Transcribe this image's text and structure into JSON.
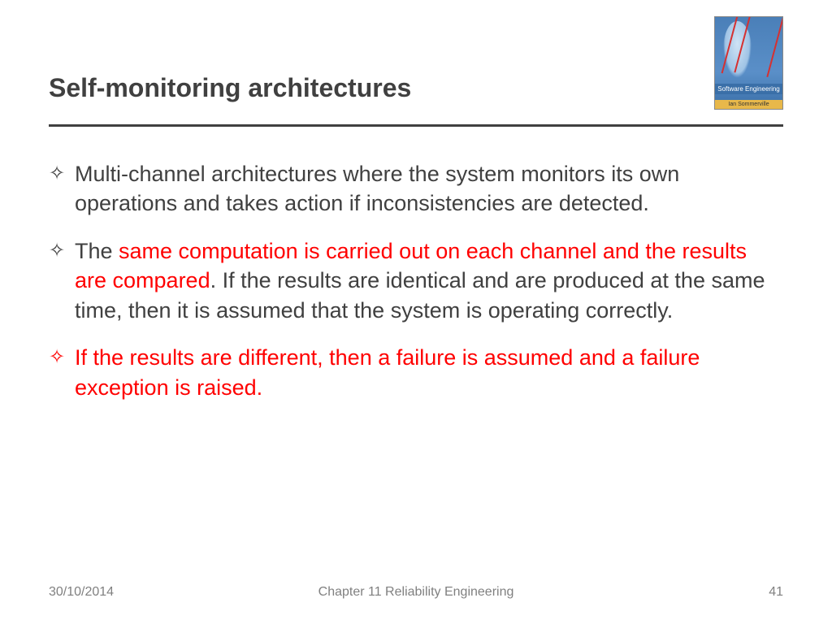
{
  "title": "Self-monitoring architectures",
  "book": {
    "label": "Software Engineering",
    "author": "Ian Sommerville"
  },
  "bullets": {
    "b1": {
      "text": "Multi-channel architectures where the system monitors its own operations and takes action if inconsistencies are detected."
    },
    "b2": {
      "prefix": "The ",
      "highlight": "same computation is carried out on each channel and the results are compared",
      "suffix": ". If the results are identical and are produced at the same time, then it is assumed that the system is operating correctly."
    },
    "b3": {
      "highlight": "If the results are different, then a failure is assumed and a failure exception is raised",
      "suffix": "."
    }
  },
  "footer": {
    "date": "30/10/2014",
    "chapter": "Chapter 11 Reliability Engineering",
    "page": "41"
  }
}
